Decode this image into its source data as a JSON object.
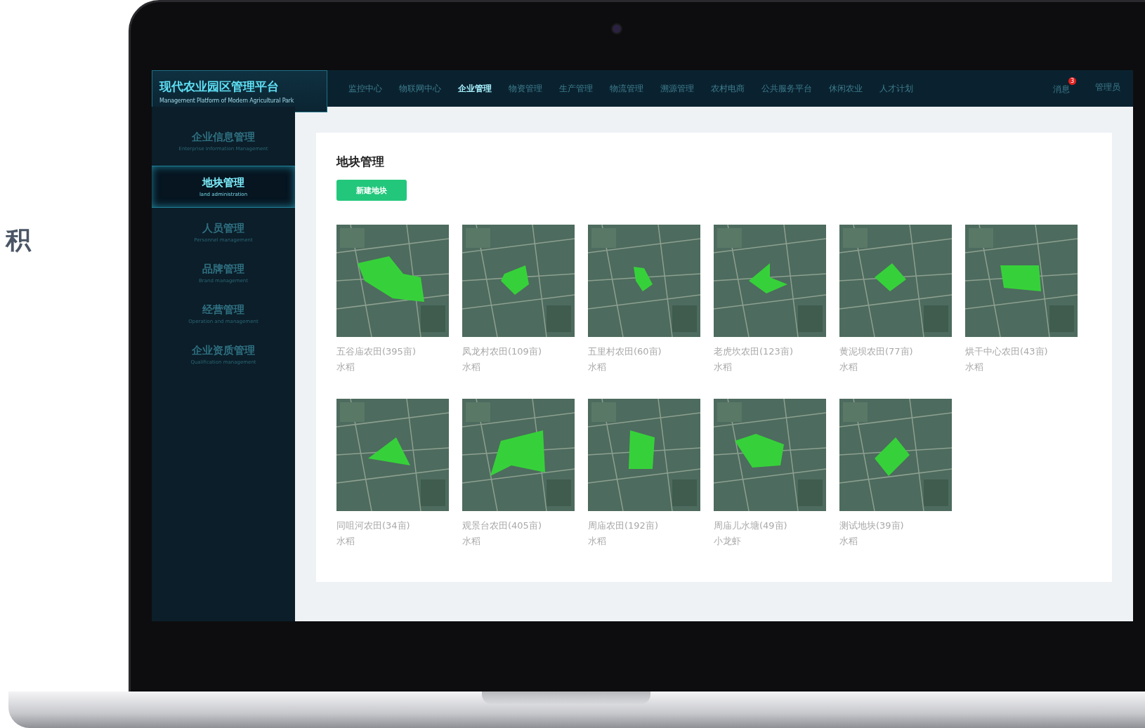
{
  "side_caption": "积",
  "app": {
    "title": "现代农业园区管理平台",
    "subtitle": "Management Platform of Modern Agricultural Park"
  },
  "nav": [
    {
      "label": "监控中心",
      "selected": false
    },
    {
      "label": "物联网中心",
      "selected": false
    },
    {
      "label": "企业管理",
      "selected": true
    },
    {
      "label": "物资管理",
      "selected": false
    },
    {
      "label": "生产管理",
      "selected": false
    },
    {
      "label": "物流管理",
      "selected": false
    },
    {
      "label": "溯源管理",
      "selected": false
    },
    {
      "label": "农村电商",
      "selected": false
    },
    {
      "label": "公共服务平台",
      "selected": false
    },
    {
      "label": "休闲农业",
      "selected": false
    },
    {
      "label": "人才计划",
      "selected": false
    }
  ],
  "messages": {
    "label": "消息",
    "badge": "3"
  },
  "user": "管理员",
  "sidebar": [
    {
      "label": "企业信息管理",
      "subtitle": "Enterprise Information Management",
      "selected": false
    },
    {
      "label": "地块管理",
      "subtitle": "land administration",
      "selected": true
    },
    {
      "label": "人员管理",
      "subtitle": "Personnel management",
      "selected": false
    },
    {
      "label": "品牌管理",
      "subtitle": "Brand management",
      "selected": false
    },
    {
      "label": "经营管理",
      "subtitle": "Operation and management",
      "selected": false
    },
    {
      "label": "企业资质管理",
      "subtitle": "Qualification management",
      "selected": false
    }
  ],
  "page_title": "地块管理",
  "new_button": "新建地块",
  "plots": [
    {
      "name": "五谷庙农田(395亩)",
      "crop": "水稻"
    },
    {
      "name": "凤龙村农田(109亩)",
      "crop": "水稻"
    },
    {
      "name": "五里村农田(60亩)",
      "crop": "水稻"
    },
    {
      "name": "老虎坎农田(123亩)",
      "crop": "水稻"
    },
    {
      "name": "黄泥坝农田(77亩)",
      "crop": "水稻"
    },
    {
      "name": "烘干中心农田(43亩)",
      "crop": "水稻"
    },
    {
      "name": "同咀河农田(34亩)",
      "crop": "水稻"
    },
    {
      "name": "观景台农田(405亩)",
      "crop": "水稻"
    },
    {
      "name": "周庙农田(192亩)",
      "crop": "水稻"
    },
    {
      "name": "周庙儿水塘(49亩)",
      "crop": "小龙虾"
    },
    {
      "name": "测试地块(39亩)",
      "crop": "水稻"
    }
  ]
}
